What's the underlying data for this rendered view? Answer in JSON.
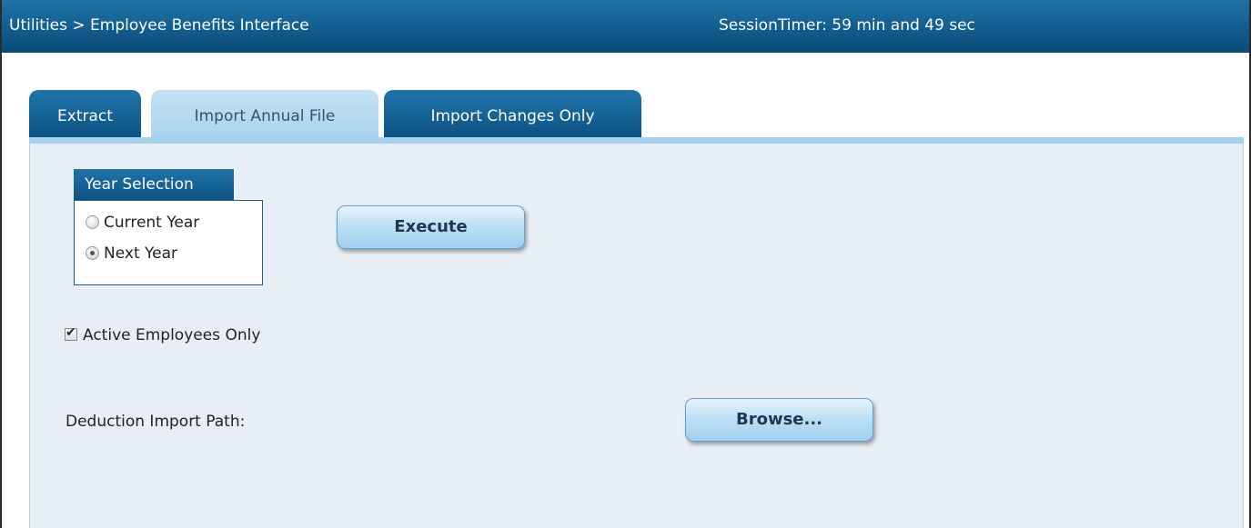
{
  "header": {
    "breadcrumb": "Utilities > Employee Benefits Interface",
    "session_timer": "SessionTimer: 59 min and 49 sec"
  },
  "tabs": [
    {
      "label": "Extract",
      "active": false
    },
    {
      "label": "Import Annual File",
      "active": true
    },
    {
      "label": "Import Changes Only",
      "active": false
    }
  ],
  "year_selection": {
    "title": "Year Selection",
    "options": [
      {
        "label": "Current Year",
        "selected": false
      },
      {
        "label": "Next Year",
        "selected": true
      }
    ]
  },
  "execute_button": {
    "label": "Execute"
  },
  "active_employees": {
    "label": "Active Employees Only",
    "checked": true
  },
  "deduction_import": {
    "label": "Deduction Import Path:",
    "browse_label": "Browse..."
  },
  "colors": {
    "header_blue": "#125d8f",
    "active_tab": "#a8d3ee",
    "panel_bg": "#e8eef6"
  }
}
